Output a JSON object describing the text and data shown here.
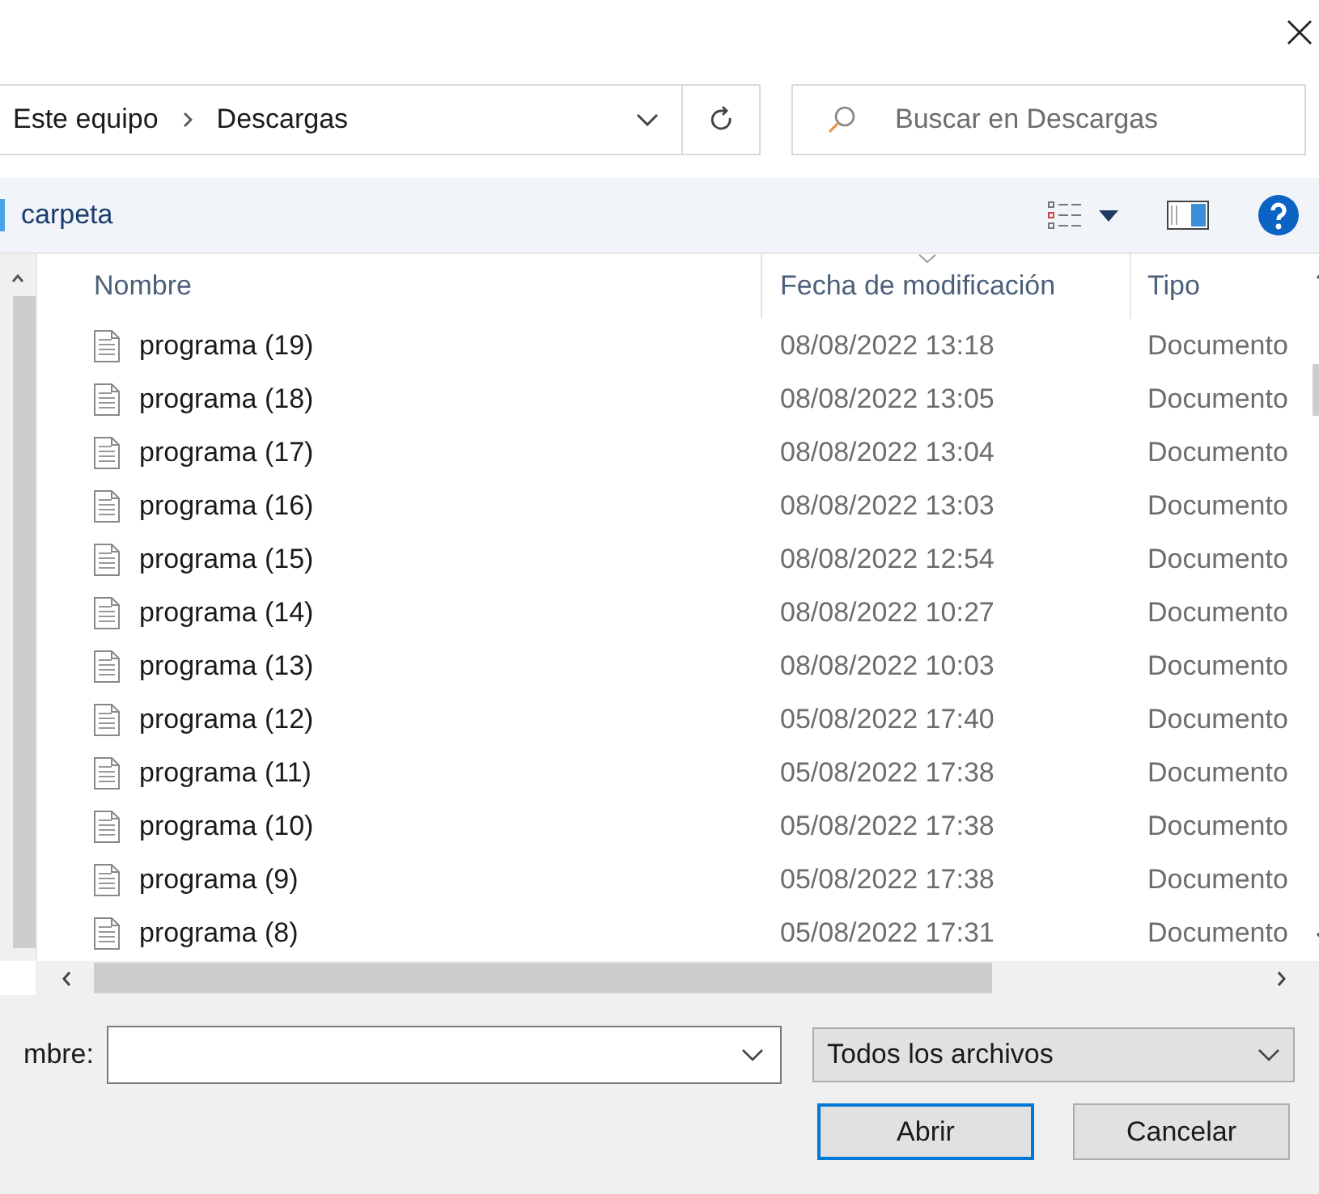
{
  "address": {
    "path": [
      "Este equipo",
      "Descargas"
    ]
  },
  "search": {
    "placeholder": "Buscar en Descargas"
  },
  "toolbar": {
    "new_folder": "carpeta"
  },
  "table": {
    "columns": [
      {
        "label": "Nombre",
        "sorted": false
      },
      {
        "label": "Fecha de modificación",
        "sorted": true
      },
      {
        "label": "Tipo",
        "sorted": false
      }
    ],
    "rows": [
      {
        "name": "programa (19)",
        "date": "08/08/2022 13:18",
        "type": "Documento",
        "selected": false
      },
      {
        "name": "programa (18)",
        "date": "08/08/2022 13:05",
        "type": "Documento",
        "selected": false
      },
      {
        "name": "programa (17)",
        "date": "08/08/2022 13:04",
        "type": "Documento",
        "selected": false
      },
      {
        "name": "programa (16)",
        "date": "08/08/2022 13:03",
        "type": "Documento",
        "selected": false
      },
      {
        "name": "programa (15)",
        "date": "08/08/2022 12:54",
        "type": "Documento",
        "selected": false
      },
      {
        "name": "programa (14)",
        "date": "08/08/2022 10:27",
        "type": "Documento",
        "selected": false
      },
      {
        "name": "programa (13)",
        "date": "08/08/2022 10:03",
        "type": "Documento",
        "selected": false
      },
      {
        "name": "programa (12)",
        "date": "05/08/2022 17:40",
        "type": "Documento",
        "selected": false
      },
      {
        "name": "programa (11)",
        "date": "05/08/2022 17:38",
        "type": "Documento",
        "selected": false
      },
      {
        "name": "programa (10)",
        "date": "05/08/2022 17:38",
        "type": "Documento",
        "selected": false
      },
      {
        "name": "programa (9)",
        "date": "05/08/2022 17:38",
        "type": "Documento",
        "selected": false
      },
      {
        "name": "programa (8)",
        "date": "05/08/2022 17:31",
        "type": "Documento",
        "selected": false
      }
    ]
  },
  "file_name": {
    "label": "mbre:"
  },
  "filter": {
    "value": "Todos los archivos"
  },
  "buttons": [
    {
      "label": "Abrir",
      "default": true
    },
    {
      "label": "Cancelar",
      "default": false
    }
  ]
}
